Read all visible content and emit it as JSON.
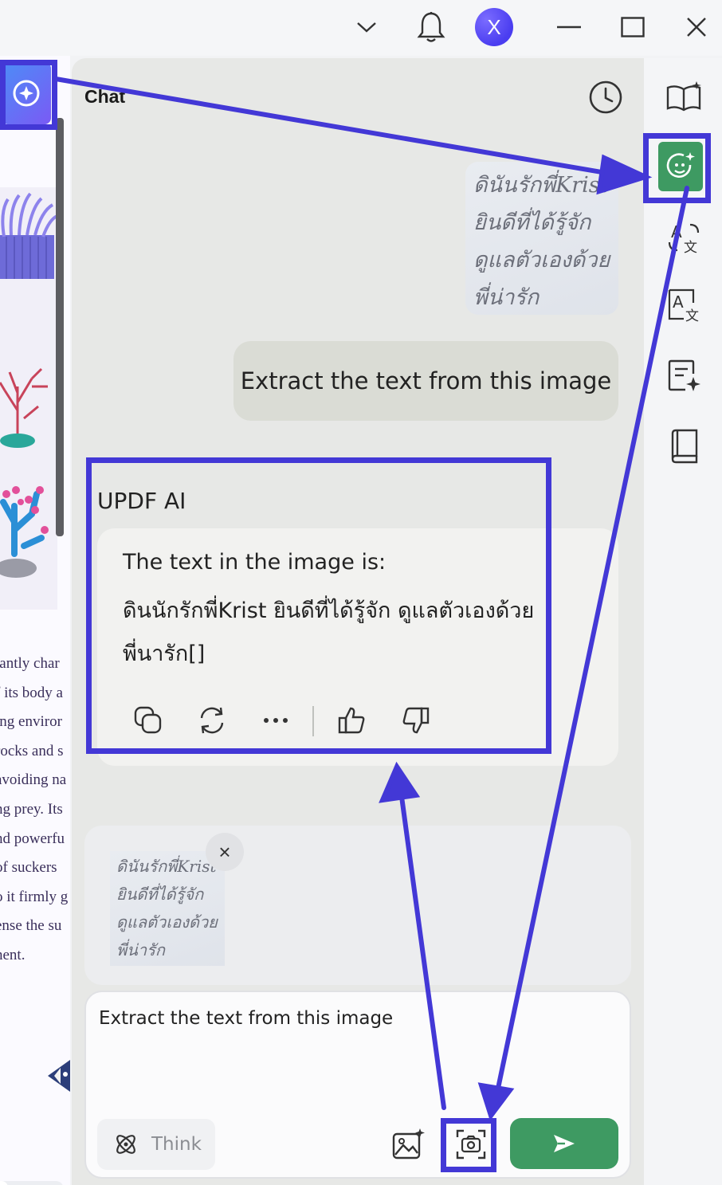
{
  "titlebar": {
    "avatar_letter": "X",
    "icons": [
      "chevron-down-icon",
      "bell-icon",
      "minimize-icon",
      "maximize-icon",
      "close-icon"
    ]
  },
  "document": {
    "text_lines": [
      "tantly char",
      "f its body a",
      "ing enviror",
      "rocks and s",
      "avoiding na",
      "ng prey. Its",
      "nd powerfu",
      " of suckers",
      "o it firmly g",
      "ense the su",
      "nent."
    ],
    "zoom_minus": "—"
  },
  "panel": {
    "title": "Chat"
  },
  "rail": {
    "items": [
      "book-sparkle-icon",
      "ai-chat-icon",
      "translate-icon",
      "translate-box-icon",
      "summarize-icon",
      "book-icon"
    ]
  },
  "conversation": {
    "attached_image_lines": [
      "ดินันรักพี่Krist",
      "ยินดีที่ได้รู้จัก",
      "ดูแลตัวเองด้วย",
      "พี่น่ารัก"
    ],
    "user_message": "Extract the text from this image",
    "ai_name": "UPDF AI",
    "ai_lines": [
      "The text in the image is:",
      "ดินนักรักพี่Krist ยินดีที่ได้รู้จัก ดูแลตัวเองด้วย",
      "พี่นารัก[]"
    ],
    "ai_actions": [
      "copy-icon",
      "regenerate-icon",
      "more-icon",
      "thumbs-up-icon",
      "thumbs-down-icon"
    ]
  },
  "composer": {
    "thumb_close": "×",
    "input_value": "Extract the text from this image",
    "think_label": "Think"
  },
  "colors": {
    "accent_green": "#3e9a62",
    "annotation_blue": "#4338d6"
  }
}
